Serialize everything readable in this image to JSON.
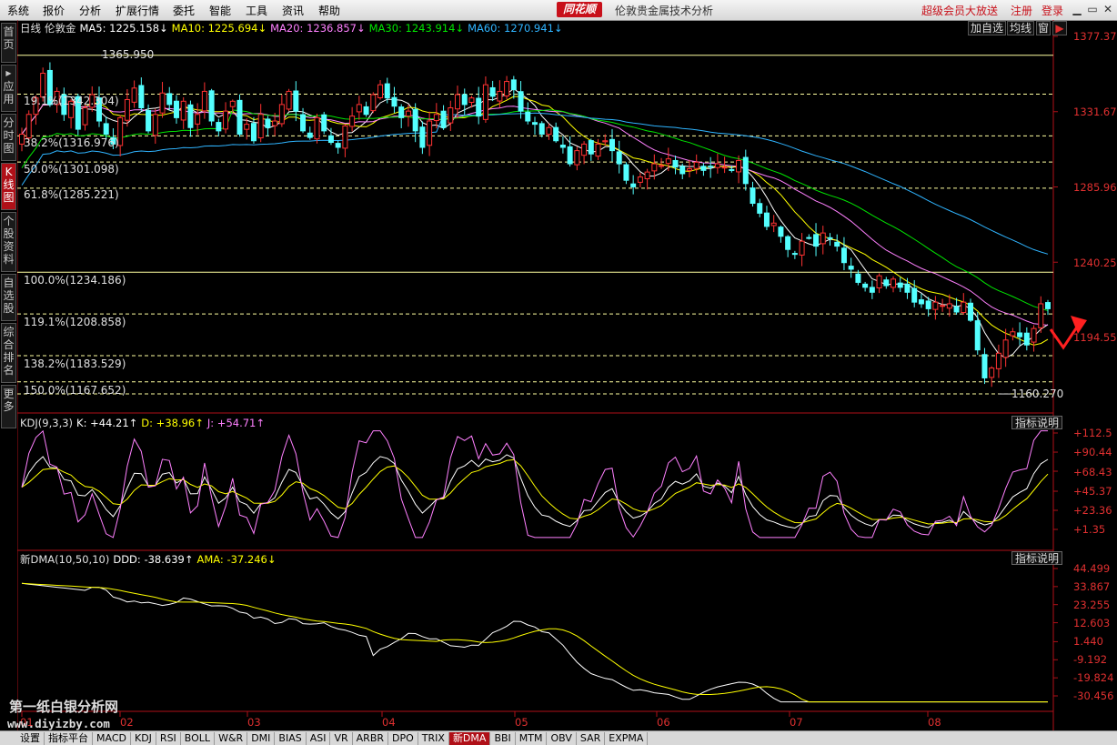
{
  "menubar": {
    "items": [
      "系统",
      "报价",
      "分析",
      "扩展行情",
      "委托",
      "智能",
      "工具",
      "资讯",
      "帮助"
    ],
    "logo": "同花顺",
    "title": "伦敦贵金属技术分析",
    "vip": "超级会员大放送",
    "register": "注册",
    "login": "登录"
  },
  "leftbar": [
    {
      "label": "首页"
    },
    {
      "label": "应用"
    },
    {
      "label": "分时图"
    },
    {
      "label": "K线图"
    },
    {
      "label": "个股资料"
    },
    {
      "label": "自选股"
    },
    {
      "label": "综合排名"
    },
    {
      "label": "更多"
    }
  ],
  "main_header": {
    "period": "日线",
    "symbol": "伦敦金",
    "ma5": "MA5: 1225.158↓",
    "ma10": "MA10: 1225.694↓",
    "ma20": "MA20: 1236.857↓",
    "ma30": "MA30: 1243.914↓",
    "ma60": "MA60: 1270.941↓",
    "add_fav": "加自选",
    "ma_toggle": "均线",
    "window_icon": "窗"
  },
  "fib_levels": [
    {
      "label": "19.1%(1342.304)",
      "value": 1342.304
    },
    {
      "label": "38.2%(1316.976)",
      "value": 1316.976
    },
    {
      "label": "50.0%(1301.098)",
      "value": 1301.098
    },
    {
      "label": "61.8%(1285.221)",
      "value": 1285.221
    },
    {
      "label": "100.0%(1234.186)",
      "value": 1234.186
    },
    {
      "label": "119.1%(1208.858)",
      "value": 1208.858
    },
    {
      "label": "138.2%(1183.529)",
      "value": 1183.529
    },
    {
      "label": "150.0%(1167.652)",
      "value": 1167.652
    }
  ],
  "price_high": "1365.950",
  "price_low": "1160.270",
  "price_axis": [
    "1377.377",
    "1331.670",
    "1285.963",
    "1240.257",
    "1194.550"
  ],
  "kdj_header": {
    "name": "KDJ(9,3,3)",
    "k": "K: +44.21↑",
    "d": "D: +38.96↑",
    "j": "J: +54.71↑",
    "help": "指标说明"
  },
  "kdj_axis": [
    "+112.5",
    "+90.44",
    "+68.43",
    "+45.37",
    "+23.36",
    "+1.35"
  ],
  "dma_header": {
    "name": "新DMA(10,50,10)",
    "ddd": "DDD: -38.639↑",
    "ama": "AMA: -37.246↓",
    "help": "指标说明"
  },
  "dma_axis": [
    "44.499",
    "33.867",
    "23.255",
    "12.603",
    "1.440",
    "-9.192",
    "-19.824",
    "-30.456"
  ],
  "x_axis": [
    "01",
    "02",
    "03",
    "04",
    "05",
    "06",
    "07",
    "08"
  ],
  "tabs": [
    "设置",
    "指标平台",
    "MACD",
    "KDJ",
    "RSI",
    "BOLL",
    "W&R",
    "DMI",
    "BIAS",
    "ASI",
    "VR",
    "ARBR",
    "DPO",
    "TRIX",
    "新DMA",
    "BBI",
    "MTM",
    "OBV",
    "SAR",
    "EXPMA"
  ],
  "active_tab": "新DMA",
  "watermark": {
    "line1": "第一纸白银分析网",
    "line2": "www.diyizby.com"
  },
  "colors": {
    "up": "#ff3232",
    "down": "#54ffff",
    "ma5": "#ffffff",
    "ma10": "#ffff00",
    "ma20": "#ff80ff",
    "ma30": "#00e600",
    "ma60": "#2fb4ff",
    "axis": "#c8101a",
    "fib_solid": "#ffff80",
    "fib_dash": "#ffff80"
  },
  "chart_data": {
    "type": "candlestick",
    "ylim": [
      1150,
      1385
    ],
    "note_values_close": [
      1318,
      1330,
      1340,
      1355,
      1336,
      1344,
      1330,
      1338,
      1321,
      1334,
      1342,
      1326,
      1318,
      1312,
      1328,
      1339,
      1346,
      1334,
      1320,
      1330,
      1343,
      1336,
      1328,
      1338,
      1322,
      1330,
      1344,
      1326,
      1320,
      1332,
      1338,
      1318,
      1324,
      1314,
      1330,
      1322,
      1326,
      1336,
      1344,
      1332,
      1320,
      1316,
      1328,
      1320,
      1313,
      1310,
      1323,
      1329,
      1336,
      1330,
      1342,
      1348,
      1340,
      1335,
      1328,
      1332,
      1320,
      1310,
      1326,
      1330,
      1322,
      1334,
      1342,
      1336,
      1340,
      1329,
      1348,
      1341,
      1344,
      1350,
      1345,
      1332,
      1326,
      1324,
      1318,
      1322,
      1314,
      1310,
      1300,
      1308,
      1312,
      1306,
      1312,
      1314,
      1308,
      1300,
      1290,
      1286,
      1292,
      1295,
      1300,
      1299,
      1303,
      1298,
      1294,
      1297,
      1301,
      1296,
      1298,
      1300,
      1298,
      1296,
      1302,
      1288,
      1276,
      1270,
      1262,
      1264,
      1256,
      1248,
      1245,
      1253,
      1255,
      1250,
      1258,
      1255,
      1250,
      1240,
      1236,
      1228,
      1225,
      1222,
      1232,
      1226,
      1230,
      1225,
      1222,
      1216,
      1215,
      1212,
      1216,
      1214,
      1215,
      1210,
      1216,
      1205,
      1187,
      1170,
      1176,
      1185,
      1193,
      1198,
      1195,
      1190,
      1200,
      1215,
      1212
    ],
    "series": [
      {
        "name": "MA5",
        "values_ref": "close"
      },
      {
        "name": "MA10"
      },
      {
        "name": "MA20"
      },
      {
        "name": "MA30"
      },
      {
        "name": "MA60"
      }
    ]
  }
}
